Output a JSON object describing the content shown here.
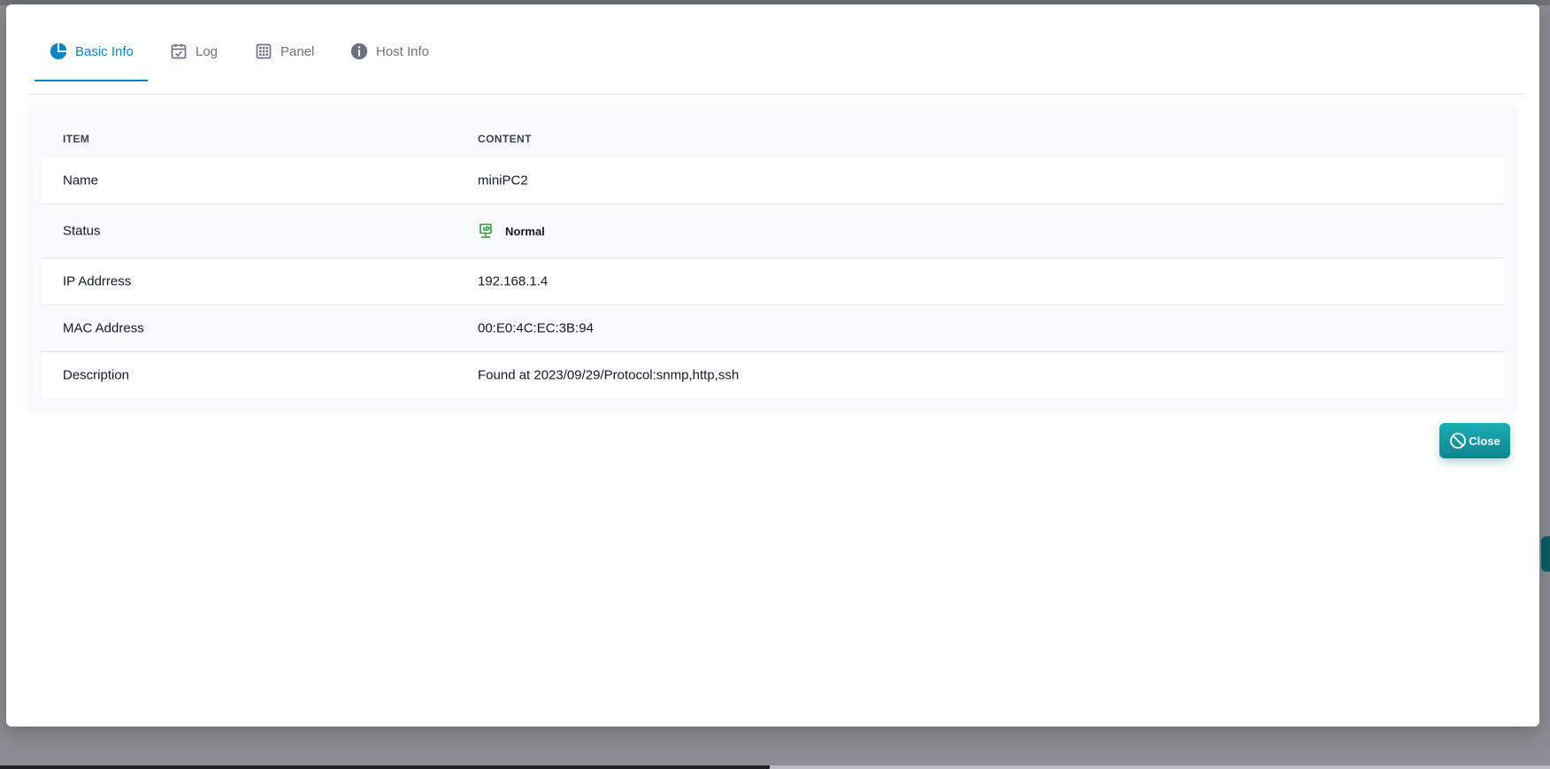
{
  "tabs": [
    {
      "label": "Basic Info",
      "icon": "pie-chart-icon",
      "active": true
    },
    {
      "label": "Log",
      "icon": "calendar-check-icon",
      "active": false
    },
    {
      "label": "Panel",
      "icon": "grid-icon",
      "active": false
    },
    {
      "label": "Host Info",
      "icon": "info-circle-icon",
      "active": false
    }
  ],
  "table": {
    "headers": {
      "item": "ITEM",
      "content": "CONTENT"
    },
    "rows": [
      {
        "item": "Name",
        "content": "miniPC2"
      },
      {
        "item": "Status",
        "content": "Normal",
        "icon": "lan-port-icon"
      },
      {
        "item": "IP Addrress",
        "content": "192.168.1.4"
      },
      {
        "item": "MAC Address",
        "content": "00:E0:4C:EC:3B:94"
      },
      {
        "item": "Description",
        "content": "Found at 2023/09/29/Protocol:snmp,http,ssh"
      }
    ]
  },
  "close_button": {
    "label": "Close",
    "icon": "block-icon"
  },
  "colors": {
    "accent": "#0b84c6",
    "close_button": "#1aaeb5",
    "status_ok": "#2e9b3f"
  }
}
